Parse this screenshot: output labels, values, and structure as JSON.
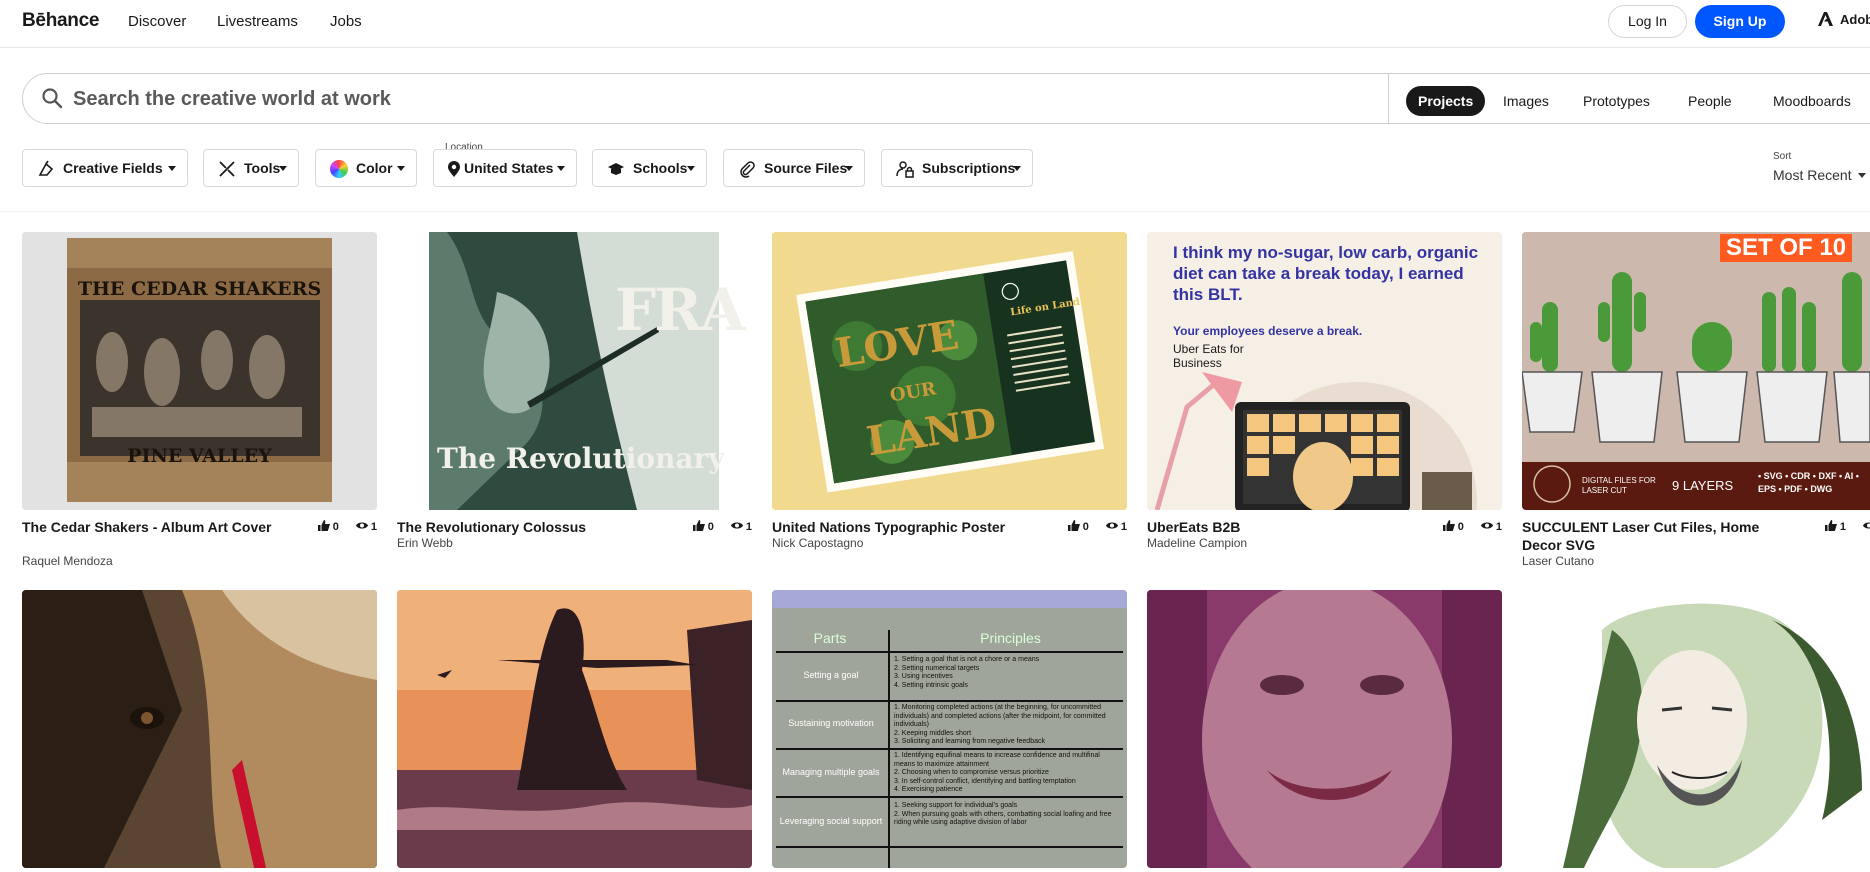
{
  "brand": {
    "logo": "Bēhance",
    "adobe": "Adob"
  },
  "nav": {
    "discover": "Discover",
    "livestreams": "Livestreams",
    "jobs": "Jobs",
    "login": "Log In",
    "signup": "Sign Up"
  },
  "search": {
    "placeholder": "Search the creative world at work",
    "tabs": [
      "Projects",
      "Images",
      "Prototypes",
      "People",
      "Moodboards"
    ],
    "active_tab": "Projects"
  },
  "filters": {
    "creative_fields": "Creative Fields",
    "tools": "Tools",
    "color": "Color",
    "location_label": "Location",
    "location": "United States",
    "schools": "Schools",
    "source_files": "Source Files",
    "subscriptions": "Subscriptions",
    "sort_label": "Sort",
    "sort_value": "Most Recent"
  },
  "colors": {
    "accent": "#0057ff",
    "text": "#191919"
  },
  "projects": [
    {
      "title": "The Cedar Shakers - Album Art Cover",
      "owner": "Raquel Mendoza",
      "likes": "0",
      "views": "1",
      "art_top": "THE CEDAR SHAKERS",
      "art_bottom": "PINE VALLEY"
    },
    {
      "title": "The Revolutionary Colossus",
      "owner": "Erin Webb",
      "likes": "0",
      "views": "1",
      "art_top": "FRA",
      "art_bottom": "The Revolutionary"
    },
    {
      "title": "United Nations Typographic Poster",
      "owner": "Nick Capostagno",
      "likes": "0",
      "views": "1",
      "art_top": "Life on Land",
      "art_bottom": "LOVE OUR LAND"
    },
    {
      "title": "UberEats B2B",
      "owner": "Madeline Campion",
      "likes": "0",
      "views": "1",
      "art_top": "I think my no-sugar, low carb, organic diet can take a break today, I earned this BLT.",
      "art_bottom": "Your employees deserve a break.",
      "art_brand": "Uber Eats for Business"
    },
    {
      "title": "SUCCULENT Laser Cut Files, Home Decor SVG",
      "owner": "Laser Cutano",
      "likes": "1",
      "views": "",
      "art_top": "SET OF 10",
      "art_bottom": "9 LAYERS",
      "art_formats": "• SVG • CDR • DXF • AI • EPS • PDF • DWG",
      "art_digital": "DIGITAL FILES FOR LASER CUT"
    }
  ],
  "table_art": {
    "headers": [
      "Parts",
      "Principles"
    ],
    "rows": [
      {
        "part": "Setting a goal",
        "items": [
          "1. Setting a goal that is not a chore or a means",
          "2. Setting numerical targets",
          "3. Using incentives",
          "4. Setting intrinsic goals"
        ]
      },
      {
        "part": "Sustaining motivation",
        "items": [
          "1. Monitoring completed actions (at the beginning, for uncommitted individuals) and completed actions (after the midpoint, for committed individuals)",
          "2. Keeping middles short",
          "3. Soliciting and learning from negative feedback"
        ]
      },
      {
        "part": "Managing multiple goals",
        "items": [
          "1. Identifying equifinal means to increase confidence and multifinal means to maximize attainment",
          "2. Choosing when to compromise versus prioritize",
          "3. In self-control conflict, identifying and battling temptation",
          "4. Exercising patience"
        ]
      },
      {
        "part": "Leveraging social support",
        "items": [
          "1. Seeking support for individual's goals",
          "2. When pursuing goals with others, combatting social loafing and free riding while using adaptive division of labor"
        ]
      }
    ]
  }
}
